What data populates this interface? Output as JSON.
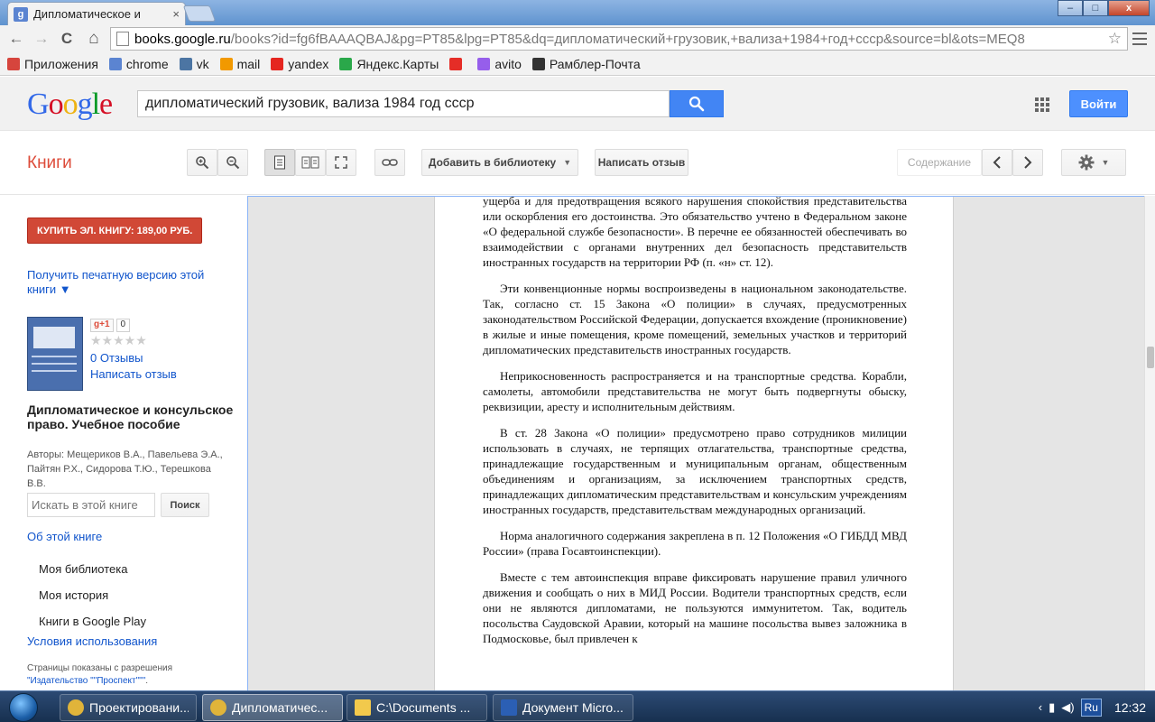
{
  "browser": {
    "tab_title": "Дипломатическое и",
    "tab_close": "×",
    "win_minimize": "–",
    "win_maximize": "□",
    "win_close": "x",
    "nav_back": "←",
    "nav_forward": "→",
    "nav_reload": "C",
    "nav_home": "⌂",
    "url_host": "books.google.ru",
    "url_rest": "/books?id=fg6fBAAAQBAJ&pg=PT85&lpg=PT85&dq=дипломатический+грузовик,+ва­лиза+1984+год+ссср&source=bl&ots=MEQ8",
    "star": "☆",
    "bookmarks": [
      {
        "label": "Приложения",
        "icon": "apps-icon",
        "color": "#d6453d"
      },
      {
        "label": "chrome",
        "icon": "google-icon",
        "color": "#5b84d1"
      },
      {
        "label": "vk",
        "icon": "vk-icon",
        "color": "#4c75a3"
      },
      {
        "label": "mail",
        "icon": "mail-icon",
        "color": "#f29900"
      },
      {
        "label": "yandex",
        "icon": "yandex-icon",
        "color": "#e52620"
      },
      {
        "label": "Яндекс.Карты",
        "icon": "maps-icon",
        "color": "#2aa84a"
      },
      {
        "label": "",
        "icon": "youtube-icon",
        "color": "#e52d27"
      },
      {
        "label": "avito",
        "icon": "avito-icon",
        "color": "#965eeb"
      },
      {
        "label": "Рамблер-Почта",
        "icon": "rambler-icon",
        "color": "#333333"
      }
    ]
  },
  "google": {
    "logo": [
      "G",
      "o",
      "o",
      "g",
      "l",
      "e"
    ],
    "search_value": "дипломатический грузовик, ва­лиза 1984 год ссср",
    "signin_label": "Войти"
  },
  "books_toolbar": {
    "title": "Книги",
    "add_library": "Добавить в библиотеку",
    "write_review": "Написать отзыв",
    "contents": "Содержание"
  },
  "sidebar": {
    "buy_label": "КУПИТЬ ЭЛ. КНИГУ: 189,00 РУБ.",
    "print_link": "Получить печатную версию этой книги ▼",
    "gplus_label": "g+1",
    "gplus_count": "0",
    "stars": "★★★★★",
    "rating": 0,
    "reviews_link": "0 Отзывы",
    "write_review": "Написать отзыв",
    "book_title": "Дипломатическое и консульское право. Учебное пособие",
    "authors": "Авторы: Мещериков В.А., Павельева Э.А., Пайтян Р.Х., Сидорова Т.Ю., Терешкова В.В.",
    "in_book_placeholder": "Искать в этой книге",
    "in_book_button": "Поиск",
    "about_link": "Об этой книге",
    "nav": [
      "Моя библиотека",
      "Моя история",
      "Книги в Google Play"
    ],
    "terms_link": "Условия использования",
    "pages_note_prefix": "Страницы показаны с разрешения",
    "pages_note_publisher": "\"Издательство \"\"Проспект\"\"\"",
    "pages_note_suffix": "."
  },
  "page": {
    "paragraphs": [
      "ущерба и для предотвращения всякого нарушения спокойствия представительства или оскорбления его достоинства. Это обязательство учтено в Федеральном законе «О федеральной службе безопасности». В перечне ее обязанностей обеспечивать во взаимодействии с органами внутренних дел безопасность представительств иностранных государств на территории РФ (п. «н» ст. 12).",
      "Эти конвенционные нормы воспроизведены в национальном законодательстве. Так, согласно ст. 15 Закона «О полиции» в случаях, предусмотренных законодательством Российской Федерации, допускается вхождение (проникновение) в жилые и иные помещения, кроме помещений, земельных участков и территорий дипломатических представительств иностранных государств.",
      "Неприкосновенность распространяется и на транспортные средства. Корабли, самолеты, автомобили представительства не могут быть подвергнуты обыску, реквизиции, аресту и исполнительным действиям.",
      "В ст. 28 Закона «О полиции» предусмотрено право сотрудников милиции использовать в случаях, не терпящих отлагательства, транспортные средства, принадлежащие государственным и муниципальным органам, общественным объединениям и организациям, за исключением транспортных средств, принадлежащих дипломатическим представительствам и консульским учреждениям иностранных государств, представительствам международных организаций.",
      "Норма аналогичного содержания закреплена в п. 12 Положения «О ГИБДД МВД России» (права Госавтоинспекции).",
      "Вместе с тем автоинспекция вправе фиксировать нарушение правил уличного движения и сообщать о них в МИД России. Водители транспортных средств, если они не являются дипломатами, не пользуются иммунитетом. Так, водитель посольства Саудовской Аравии, который на машине посольства вывез заложника в Подмосковье, был привлечен к"
    ]
  },
  "taskbar": {
    "items": [
      {
        "label": "Проектировани...",
        "icon": "chrome-icon",
        "color": "#e0b43a"
      },
      {
        "label": "Дипломатичес...",
        "icon": "chrome-icon",
        "color": "#e0b43a"
      },
      {
        "label": "C:\\Documents ...",
        "icon": "folder-icon",
        "color": "#f2c94c"
      },
      {
        "label": "Документ Micro...",
        "icon": "word-icon",
        "color": "#2b5fb4"
      }
    ],
    "lang": "Ru",
    "clock": "12:32"
  }
}
